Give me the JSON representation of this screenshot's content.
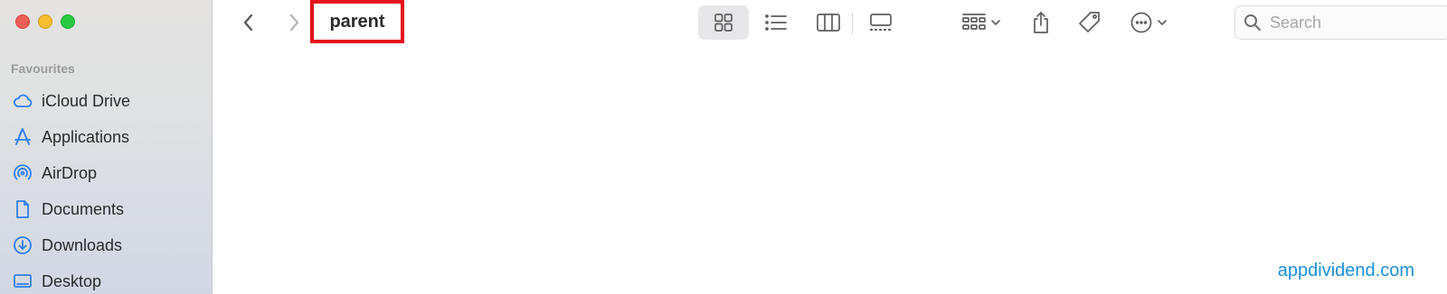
{
  "window": {
    "title": "parent"
  },
  "sidebar": {
    "section_label": "Favourites",
    "items": [
      {
        "label": "iCloud Drive",
        "icon": "cloud-icon"
      },
      {
        "label": "Applications",
        "icon": "applications-icon"
      },
      {
        "label": "AirDrop",
        "icon": "airdrop-icon"
      },
      {
        "label": "Documents",
        "icon": "document-icon"
      },
      {
        "label": "Downloads",
        "icon": "download-icon"
      },
      {
        "label": "Desktop",
        "icon": "desktop-icon"
      }
    ]
  },
  "toolbar": {
    "active_view": "icons",
    "search_placeholder": "Search"
  },
  "watermark": "appdividend.com",
  "colors": {
    "accent": "#2f7ff2",
    "highlight_box": "#e5121b",
    "watermark": "#1a8fd8"
  }
}
